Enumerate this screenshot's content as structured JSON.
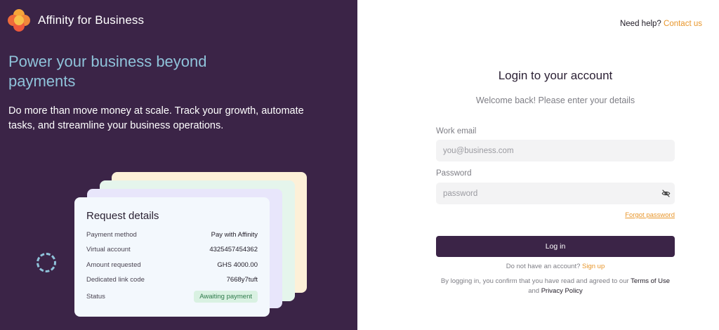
{
  "brand": {
    "name": "Affinity for Business"
  },
  "hero": {
    "headline": "Power your business beyond payments",
    "subtext": "Do more than move money at scale. Track your growth, automate tasks, and streamline your business operations."
  },
  "request_card": {
    "title": "Request details",
    "rows": [
      {
        "key": "Payment method",
        "value": "Pay with Affinity"
      },
      {
        "key": "Virtual account",
        "value": "4325457454362"
      },
      {
        "key": "Amount requested",
        "value": "GHS 4000.00"
      },
      {
        "key": "Dedicated link code",
        "value": "7668y7tuft"
      },
      {
        "key": "Status",
        "value": "Awaiting payment"
      }
    ]
  },
  "help": {
    "text": "Need help?",
    "link": "Contact us"
  },
  "login": {
    "title": "Login to your account",
    "subtitle": "Welcome back! Please enter your details",
    "email_label": "Work email",
    "email_placeholder": "you@business.com",
    "password_label": "Password",
    "password_placeholder": "password",
    "forgot": "Forgot password",
    "button": "Log in",
    "signup_text": "Do not have an account?",
    "signup_link": "Sign up",
    "terms_prefix": "By logging in, you confirm that you have read and agreed to our",
    "terms_link": "Terms of Use",
    "terms_and": "and",
    "privacy_link": "Privacy Policy"
  },
  "icons": {
    "logo": "affinity-logo-icon",
    "eye": "eye-off-icon",
    "spinner": "loading-spinner-icon"
  },
  "colors": {
    "panel": "#3b2447",
    "accent": "#e8962b",
    "headline": "#8fc3da"
  }
}
